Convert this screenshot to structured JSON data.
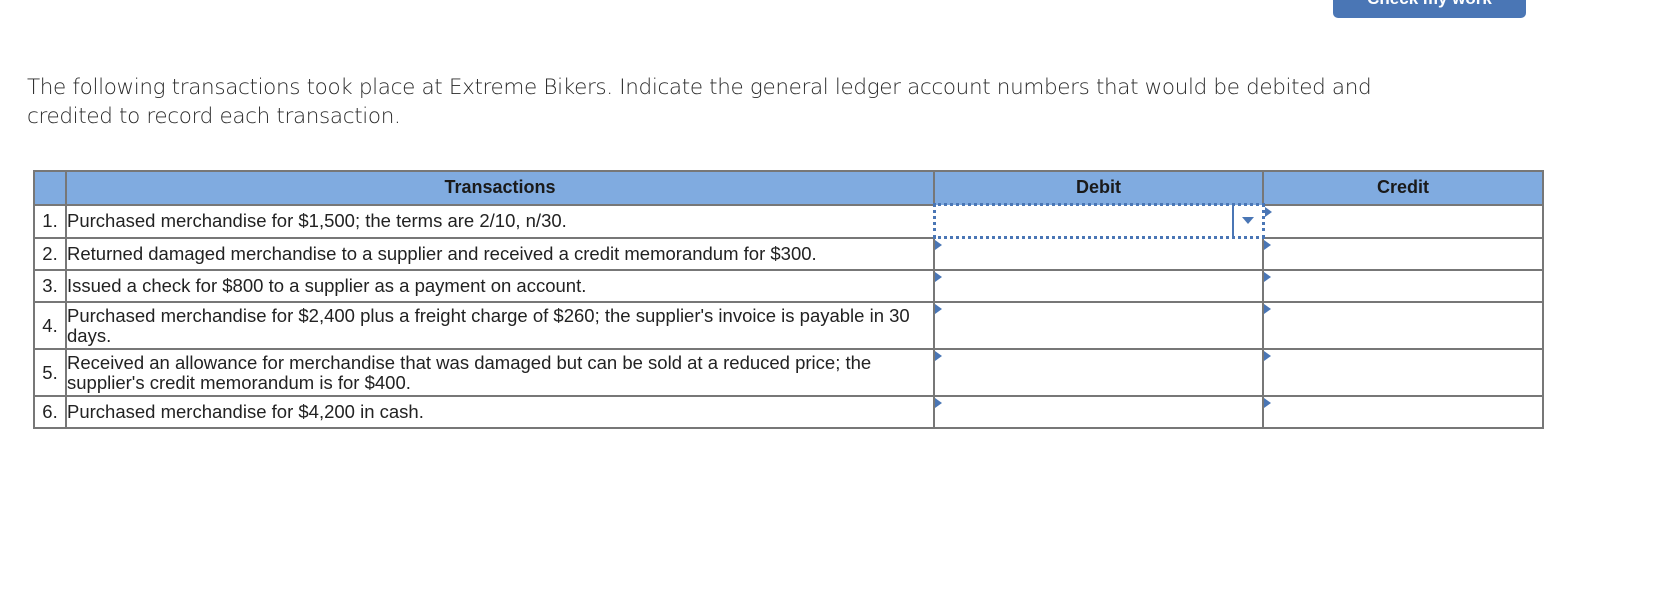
{
  "toolbar": {
    "check_button_label": "Check my work"
  },
  "instructions": "The following transactions took place at Extreme Bikers. Indicate the general ledger account numbers that would be debited and credited to record each transaction.",
  "table": {
    "headers": {
      "number": "",
      "transactions": "Transactions",
      "debit": "Debit",
      "credit": "Credit"
    },
    "rows": [
      {
        "number": "1.",
        "text": "Purchased merchandise for $1,500; the terms are 2/10, n/30.",
        "debit": "",
        "credit": ""
      },
      {
        "number": "2.",
        "text": "Returned damaged merchandise to a supplier and received a credit memorandum for $300.",
        "debit": "",
        "credit": ""
      },
      {
        "number": "3.",
        "text": "Issued a check for $800 to a supplier as a payment on account.",
        "debit": "",
        "credit": ""
      },
      {
        "number": "4.",
        "text": "Purchased merchandise for $2,400 plus a freight charge of $260; the supplier's invoice is payable in 30 days.",
        "debit": "",
        "credit": ""
      },
      {
        "number": "5.",
        "text": "Received an allowance for merchandise that was damaged but can be sold at a reduced price; the supplier's credit memorandum is for $400.",
        "debit": "",
        "credit": ""
      },
      {
        "number": "6.",
        "text": "Purchased merchandise for $4,200 in cash.",
        "debit": "",
        "credit": ""
      }
    ]
  },
  "colors": {
    "header_bg": "#80abe0",
    "accent": "#4a76b5"
  }
}
